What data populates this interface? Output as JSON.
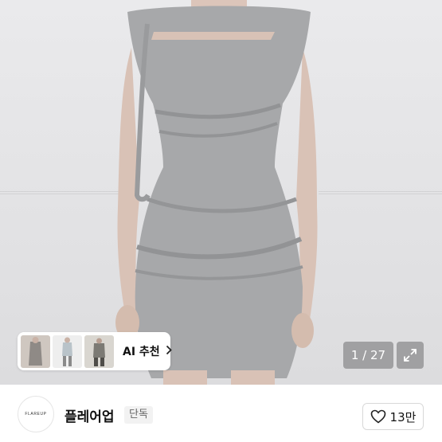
{
  "gallery": {
    "current_page": "1 / 27",
    "ai_recommend_label": "AI 추천",
    "ai_thumbnails": [
      "outfit-thumbnail-1",
      "outfit-thumbnail-2",
      "outfit-thumbnail-3"
    ]
  },
  "seller": {
    "logo_text": "FLAREUP",
    "name": "플레어업",
    "tag": "단독"
  },
  "like": {
    "count": "13만"
  },
  "icons": {
    "chevron": "chevron-right-icon",
    "expand": "expand-icon",
    "heart": "heart-outline-icon"
  },
  "colors": {
    "dress": "#a7a8aa",
    "background": "#e6e6e8"
  }
}
